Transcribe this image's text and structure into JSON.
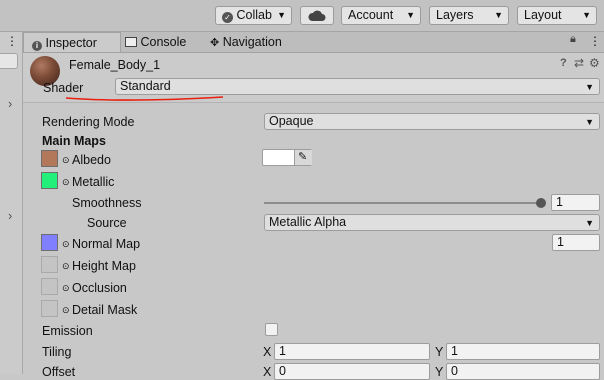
{
  "toolbar": {
    "collab": "Collab",
    "account": "Account",
    "layers": "Layers",
    "layout": "Layout"
  },
  "tabs": [
    {
      "label": "Inspector",
      "icon": "info-icon"
    },
    {
      "label": "Console",
      "icon": "console-icon"
    },
    {
      "label": "Navigation",
      "icon": "navigation-icon"
    }
  ],
  "material": {
    "name": "Female_Body_1",
    "shader_label": "Shader",
    "shader_value": "Standard"
  },
  "properties": {
    "rendering_mode_label": "Rendering Mode",
    "rendering_mode_value": "Opaque",
    "main_maps_header": "Main Maps",
    "albedo_label": "Albedo",
    "metallic_label": "Metallic",
    "smoothness_label": "Smoothness",
    "smoothness_value": "1",
    "source_label": "Source",
    "source_value": "Metallic Alpha",
    "normal_map_label": "Normal Map",
    "normal_map_value": "1",
    "height_map_label": "Height Map",
    "occlusion_label": "Occlusion",
    "detail_mask_label": "Detail Mask",
    "emission_label": "Emission",
    "tiling_label": "Tiling",
    "tiling_x": "1",
    "tiling_y": "1",
    "offset_label": "Offset",
    "offset_x": "0",
    "offset_y": "0",
    "x_label": "X",
    "y_label": "Y"
  },
  "colors": {
    "albedo": "#b3775a",
    "metallic": "#22f07a",
    "normal": "#8080ff",
    "annotation": "#e8200e"
  }
}
